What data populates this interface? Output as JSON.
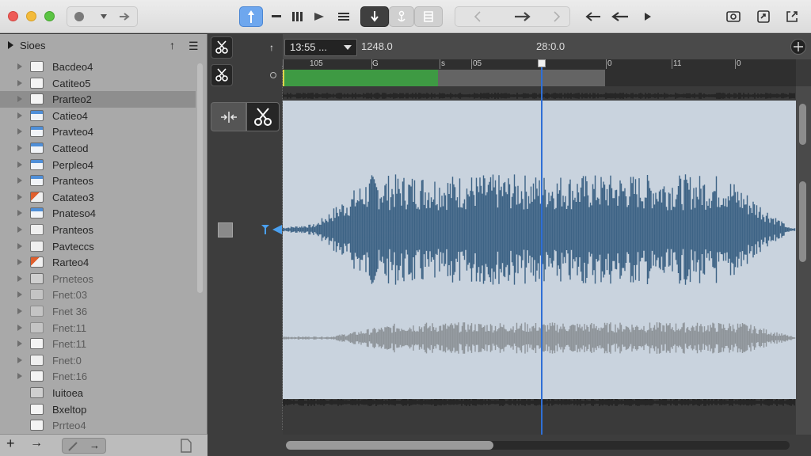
{
  "sidebar": {
    "title": "Sioes",
    "items": [
      {
        "label": "Bacdeo4",
        "icon": "folder-icon",
        "style": "folder",
        "dim": false
      },
      {
        "label": "Catiteo5",
        "icon": "folder-icon",
        "style": "folder",
        "dim": false
      },
      {
        "label": "Prarteo2",
        "icon": "folder-icon",
        "style": "folder",
        "dim": false,
        "selected": true
      },
      {
        "label": "Catieo4",
        "icon": "folder-icon",
        "style": "folder-blue",
        "dim": false
      },
      {
        "label": "Pravteo4",
        "icon": "folder-icon",
        "style": "folder-blue",
        "dim": false
      },
      {
        "label": "Catteod",
        "icon": "folder-icon",
        "style": "folder-blue",
        "dim": false
      },
      {
        "label": "Perpleo4",
        "icon": "folder-icon",
        "style": "folder-blue",
        "dim": false
      },
      {
        "label": "Pranteos",
        "icon": "folder-icon",
        "style": "folder-blue",
        "dim": false
      },
      {
        "label": "Catateo3",
        "icon": "document-icon",
        "style": "doc-red",
        "dim": false
      },
      {
        "label": "Pnateso4",
        "icon": "folder-icon",
        "style": "folder-blue",
        "dim": false
      },
      {
        "label": "Pranteos",
        "icon": "document-icon",
        "style": "doc",
        "dim": false
      },
      {
        "label": "Pavteccs",
        "icon": "document-icon",
        "style": "doc",
        "dim": false
      },
      {
        "label": "Rarteo4",
        "icon": "document-icon",
        "style": "doc-red",
        "dim": false
      },
      {
        "label": "Prneteos",
        "icon": "document-icon",
        "style": "doc-gray",
        "dim": true
      },
      {
        "label": "Fnet:03",
        "icon": "document-icon",
        "style": "dim",
        "dim": true
      },
      {
        "label": "Fnet 36",
        "icon": "document-icon",
        "style": "dim",
        "dim": true
      },
      {
        "label": "Fnet:11",
        "icon": "document-icon",
        "style": "dim",
        "dim": true
      },
      {
        "label": "Fnet:11",
        "icon": "folder-icon",
        "style": "folder",
        "dim": true
      },
      {
        "label": "Fnet:0",
        "icon": "document-icon",
        "style": "doc",
        "dim": true
      },
      {
        "label": "Fnet:16",
        "icon": "folder-icon",
        "style": "folder",
        "dim": true
      },
      {
        "label": "Iuitoea",
        "icon": "drive-icon",
        "style": "doc-gray",
        "dim": false
      },
      {
        "label": "Bxeltop",
        "icon": "folder-icon",
        "style": "folder",
        "dim": false
      },
      {
        "label": "Prrteo4",
        "icon": "folder-icon",
        "style": "folder",
        "dim": true
      }
    ],
    "footer": {
      "add": "+",
      "go": "→",
      "seg_right": "→"
    }
  },
  "timeline": {
    "timecode": "13:55 ...",
    "time_current": "1248.0",
    "time_mid": "28:0.0",
    "ticks": [
      "105",
      "G",
      "s",
      "05",
      "0",
      "11",
      "0"
    ]
  },
  "colors": {
    "accent": "#2f6fd6",
    "waveform_primary": "#3d6385",
    "waveform_secondary": "#8e9499",
    "selection_green": "#3e9a43",
    "wave_background": "#c9d3de"
  },
  "toolbar_icons": [
    "record-icon",
    "chevron-down-icon",
    "forward-icon",
    "pointer-tool-icon",
    "minus-icon",
    "bars-icon",
    "play-icon",
    "list-icon",
    "download-icon",
    "anchor-icon",
    "grid-icon",
    "back-nav-icon",
    "arrow-right-icon",
    "forward-nav-icon",
    "arrow-left-icon",
    "arrow-left-icon",
    "play-small-icon",
    "screenshot-icon",
    "loop-icon",
    "export-icon"
  ]
}
